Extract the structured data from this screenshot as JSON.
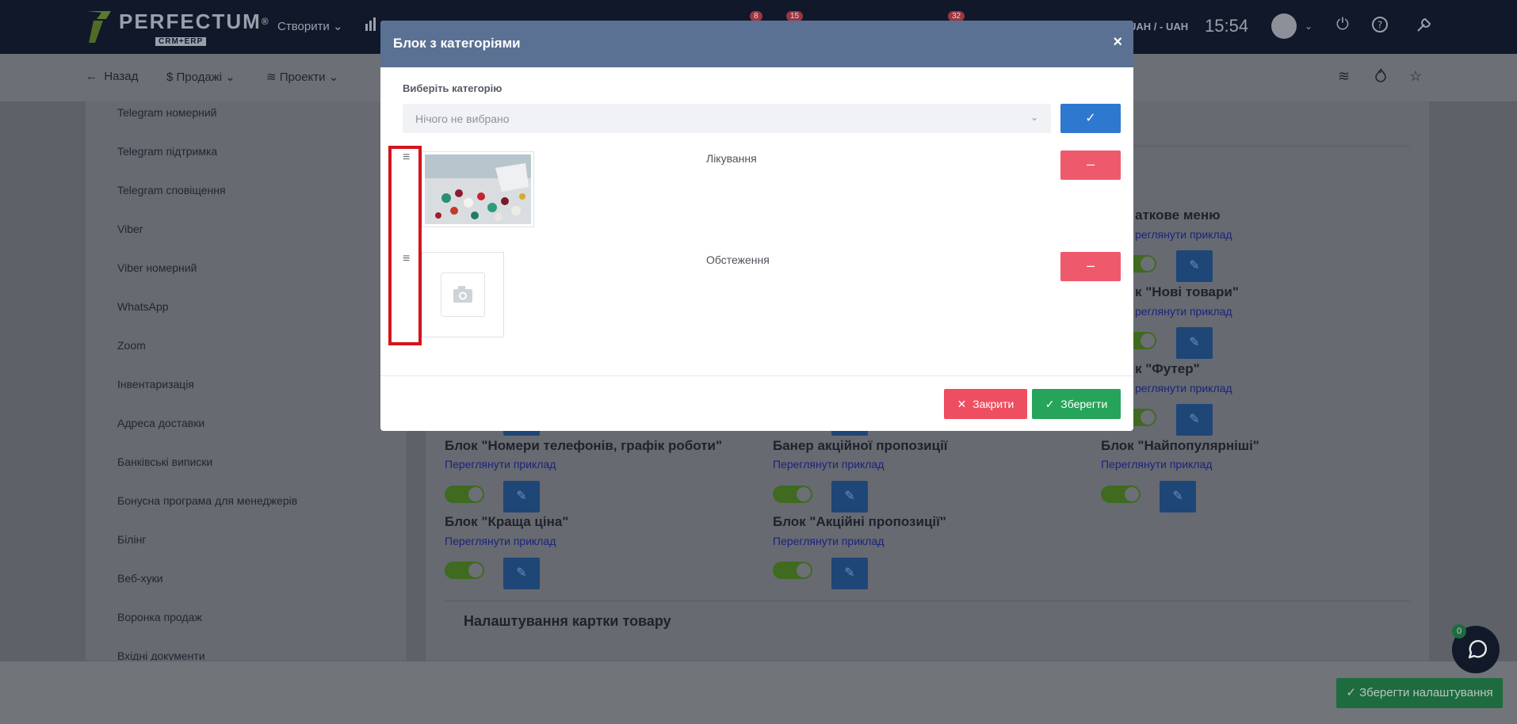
{
  "topbar": {
    "logo_title": "PERFECTUM",
    "logo_reg": "®",
    "logo_sub": "CRM+ERP",
    "create_label": "Створити",
    "badges": [
      "8",
      "15",
      "32"
    ],
    "currency": "UAH / - UAH",
    "time": "15:54"
  },
  "subbar": {
    "back_label": "Назад",
    "sales_label": "Продажі",
    "projects_label": "Проекти"
  },
  "sidebar": {
    "items": [
      "Telegram номерний",
      "Telegram підтримка",
      "Telegram сповіщення",
      "Viber",
      "Viber номерний",
      "WhatsApp",
      "Zoom",
      "Інвентаризація",
      "Адреса доставки",
      "Банківські виписки",
      "Бонусна програма для менеджерів",
      "Білінг",
      "Веб-хуки",
      "Воронка продаж",
      "Вхідні документи"
    ]
  },
  "main": {
    "partial_titles": [
      "аткове меню",
      "к \"Нові товари\"",
      "к \"Футер\""
    ],
    "partial_links": [
      "реглянути приклад",
      "реглянути приклад",
      "реглянути приклад"
    ],
    "blocks": [
      {
        "title": "Блок \"Номери телефонів, графік роботи\"",
        "link": "Переглянути приклад"
      },
      {
        "title": "Банер акційної пропозиції",
        "link": "Переглянути приклад"
      },
      {
        "title": "Блок \"Найпопулярніші\"",
        "link": "Переглянути приклад"
      },
      {
        "title": "Блок \"Краща ціна\"",
        "link": "Переглянути приклад"
      },
      {
        "title": "Блок \"Акційні пропозиції\"",
        "link": "Переглянути приклад"
      }
    ],
    "section_title": "Налаштування картки товару"
  },
  "bottom": {
    "save_settings_label": "Зберегти налаштування",
    "chat_badge": "0"
  },
  "modal": {
    "title": "Блок з категоріями",
    "close_icon": "×",
    "field_label": "Виберіть категорію",
    "select_placeholder": "Нічого не вибрано",
    "categories": [
      {
        "name": "Лікування"
      },
      {
        "name": "Обстеження"
      }
    ],
    "close_button_label": "Закрити",
    "save_button_label": "Зберегти"
  },
  "colors": {
    "modal_header": "#5a7193",
    "primary": "#2f78cf",
    "danger": "#ee5a6c",
    "success": "#27a45b",
    "highlight": "#d4141d"
  }
}
